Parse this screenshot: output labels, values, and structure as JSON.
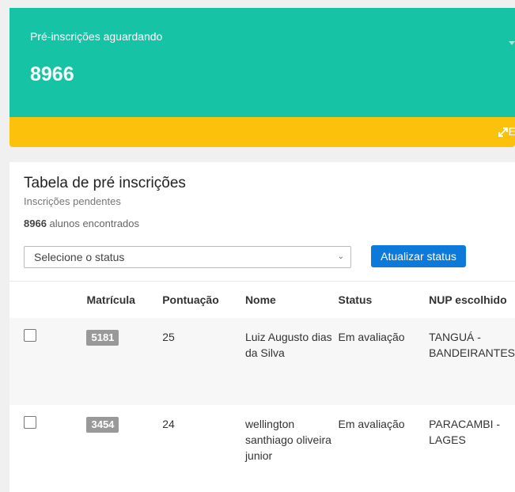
{
  "summary_card": {
    "label": "Pré-inscrições aguardando",
    "count": "8966",
    "expand_label": "E"
  },
  "panel": {
    "title": "Tabela de pré inscrições",
    "subtitle": "Inscrições pendentes",
    "found_count": "8966",
    "found_text": " alunos encontrados",
    "status_select": {
      "value": "Selecione o status"
    },
    "update_button": "Atualizar status"
  },
  "table": {
    "headers": [
      "Matrícula",
      "Pontuação",
      "Nome",
      "Status",
      "NUP escolhido"
    ],
    "rows": [
      {
        "matricula": "5181",
        "pontuacao": "25",
        "nome": "Luiz Augusto dias da Silva",
        "status": "Em avaliação",
        "nup": "TANGUÁ - BANDEIRANTES"
      },
      {
        "matricula": "3454",
        "pontuacao": "24",
        "nome": "wellington santhiago oliveira junior",
        "status": "Em avaliação",
        "nup": "PARACAMBI - LAGES"
      }
    ]
  },
  "colors": {
    "teal": "#17c3a5",
    "yellow": "#fcc10b",
    "blue": "#0d7ad9",
    "badge": "#999999"
  }
}
